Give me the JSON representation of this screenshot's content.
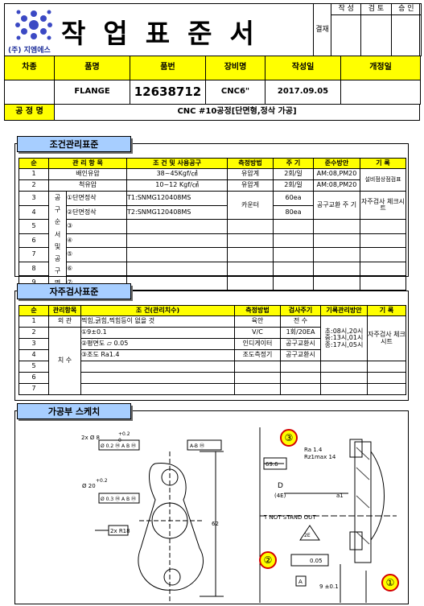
{
  "header": {
    "company": "(주) 지엠에스",
    "title": "작업표준서",
    "approval_label": "결재",
    "approval_cols": [
      "작 성",
      "검 토",
      "승 인"
    ]
  },
  "info": {
    "headers": [
      "차종",
      "품명",
      "품번",
      "장비명",
      "작성일",
      "개정일"
    ],
    "values": [
      "",
      "FLANGE",
      "12638712",
      "CNC6\"",
      "2017.09.05",
      ""
    ]
  },
  "process": {
    "label": "공 정 명",
    "value": "CNC #10공정[단면형,정삭 가공]"
  },
  "condition": {
    "title": "조건관리표준",
    "headers": [
      "순",
      "관 리 항 목",
      "조 건 및 사용공구",
      "측정방법",
      "주 기",
      "준수방안",
      "기 록"
    ],
    "rows": [
      {
        "no": "1",
        "item": "배인유압",
        "cond": "38~45Kgf/㎠",
        "method": "유압계",
        "cycle": "2회/일",
        "plan": "AM:08,PM20",
        "record": "설비점상점검표"
      },
      {
        "no": "2",
        "item": "척유압",
        "cond": "10~12 Kgf/㎠",
        "method": "유압계",
        "cycle": "2회/일",
        "plan": "AM:08,PM20",
        "record": ""
      },
      {
        "no": "3",
        "item": "①단면정삭",
        "cond": "T1:SNMG120408MS",
        "method": "카운터",
        "cycle": "60ea",
        "plan": "공구교환 주 기",
        "record": "자주검사 체크시트"
      },
      {
        "no": "4",
        "item": "②단면정삭",
        "cond": "T2:SNMG120408MS",
        "method": "",
        "cycle": "80ea",
        "plan": "",
        "record": ""
      },
      {
        "no": "5",
        "item": "③",
        "cond": "",
        "method": "",
        "cycle": "",
        "plan": "",
        "record": ""
      },
      {
        "no": "6",
        "item": "④",
        "cond": "",
        "method": "",
        "cycle": "",
        "plan": "",
        "record": ""
      },
      {
        "no": "7",
        "item": "⑤",
        "cond": "",
        "method": "",
        "cycle": "",
        "plan": "",
        "record": ""
      },
      {
        "no": "8",
        "item": "⑥",
        "cond": "",
        "method": "",
        "cycle": "",
        "plan": "",
        "record": ""
      },
      {
        "no": "9",
        "item": "⑦",
        "cond": "",
        "method": "",
        "cycle": "",
        "plan": "",
        "record": ""
      }
    ],
    "tool_group_label": "공구 순서 및 공구명"
  },
  "inspection": {
    "title": "자주검사표준",
    "headers": [
      "순",
      "관리항목",
      "조 건(관리치수)",
      "측정방법",
      "검사주기",
      "기록관리방안",
      "기 록"
    ],
    "rows": [
      {
        "no": "1",
        "item": "외 관",
        "cond": "찍힘,긁힘,찍힘등이 없을 것",
        "method": "육안",
        "cycle": "전 수"
      },
      {
        "no": "2",
        "item": "",
        "cond": "①9±0.1",
        "method": "V/C",
        "cycle": "1회/20EA"
      },
      {
        "no": "3",
        "item": "",
        "cond": "②평면도 ▱     0.05",
        "method": "인디게이터",
        "cycle": "공구교환시"
      },
      {
        "no": "4",
        "item": "",
        "cond": "③조도 Ra1.4",
        "method": "조도측정기",
        "cycle": "공구교환시"
      },
      {
        "no": "5",
        "item": "",
        "cond": "",
        "method": "",
        "cycle": ""
      },
      {
        "no": "6",
        "item": "",
        "cond": "",
        "method": "",
        "cycle": ""
      },
      {
        "no": "7",
        "item": "",
        "cond": "",
        "method": "",
        "cycle": ""
      }
    ],
    "dim_label": "치 수",
    "plan_text": "초:08시,20시 중:13시,01시 종:17시,05시",
    "record_text": "자주검사 체크시트"
  },
  "sketch": {
    "title": "가공부 스케치",
    "labels": {
      "d8": "2x Ø 8",
      "tol_p2": "+0.2",
      "tol_0": "0",
      "fcf1": "Ø 0.2 Ⓜ A B Ⓜ",
      "d20": "Ø 20",
      "fcf2": "Ø 0.3 Ⓜ A B Ⓜ",
      "r18": "2x R18",
      "h62": "62",
      "dimA": "A-B Ⓜ",
      "c1": "③",
      "c2": "②",
      "c3": "①",
      "ra": "Ra 1.4",
      "rz": "Rz1max 14",
      "d696": "69.6",
      "D": "D",
      "4E": "(4E)",
      "a1": "a1",
      "note": "T NOT STAND OUT",
      "2E": "2E",
      "flat": "0.05",
      "A": "A",
      "nine": "9 ±0.1"
    }
  }
}
